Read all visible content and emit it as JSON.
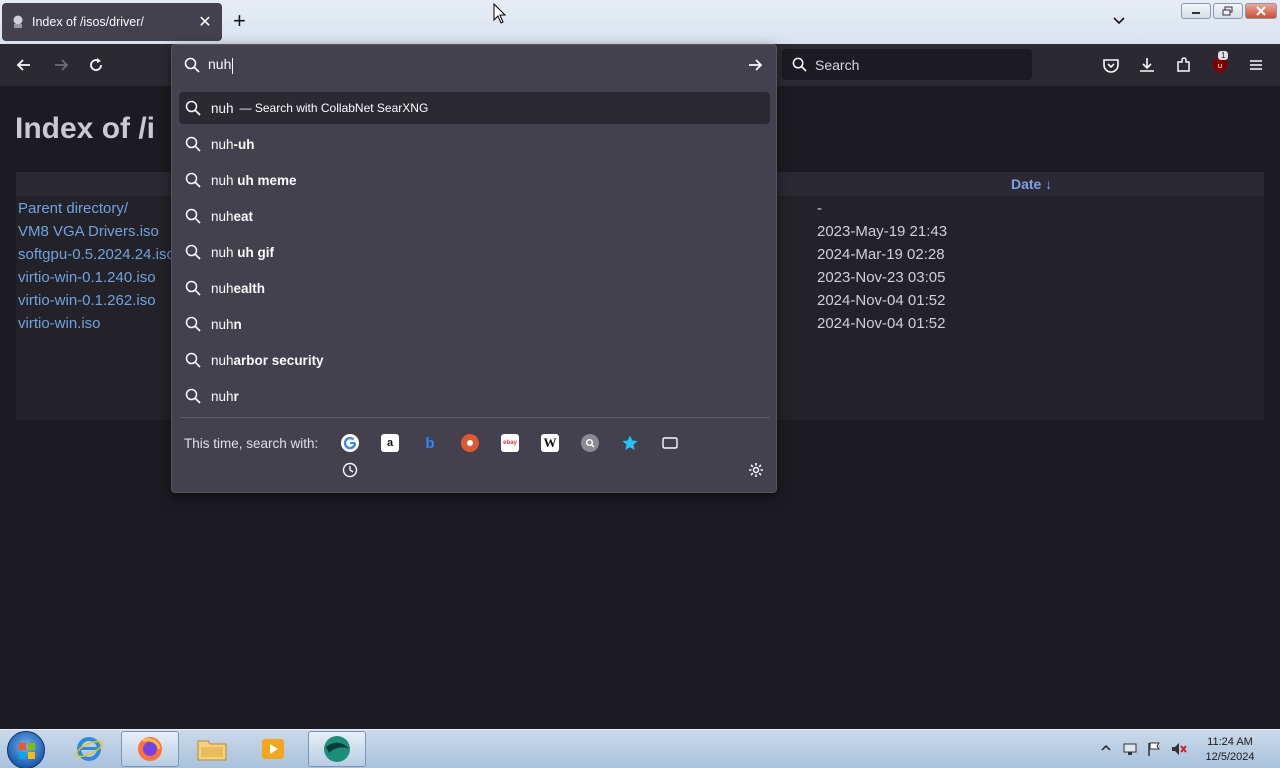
{
  "browser": {
    "tab": {
      "title": "Index of /isos/driver/",
      "close_glyph": "✕"
    },
    "new_tab_glyph": "+",
    "search_placeholder": "Search",
    "extension_badge": "1"
  },
  "page": {
    "title": "Index of /i",
    "date_header": "Date ↓",
    "files": [
      {
        "name": "Parent directory/",
        "date": "-"
      },
      {
        "name": "VM8 VGA Drivers.iso",
        "date": "2023-May-19 21:43"
      },
      {
        "name": "softgpu-0.5.2024.24.iso",
        "date": "2024-Mar-19 02:28"
      },
      {
        "name": "virtio-win-0.1.240.iso",
        "date": "2023-Nov-23 03:05"
      },
      {
        "name": "virtio-win-0.1.262.iso",
        "date": "2024-Nov-04 01:52"
      },
      {
        "name": "virtio-win.iso",
        "date": "2024-Nov-04 01:52"
      }
    ]
  },
  "urlbar": {
    "value": "nuh",
    "first_suggestion": {
      "text": "nuh",
      "engine_label": "— Search with CollabNet SearXNG"
    },
    "suggestions": [
      {
        "prefix": "nuh",
        "bold": "-uh"
      },
      {
        "prefix": "nuh ",
        "bold": "uh meme"
      },
      {
        "prefix": "nuh",
        "bold": "eat"
      },
      {
        "prefix": "nuh ",
        "bold": "uh gif"
      },
      {
        "prefix": "nuh",
        "bold": "ealth"
      },
      {
        "prefix": "nuh",
        "bold": "n"
      },
      {
        "prefix": "nuh",
        "bold": "arbor security"
      },
      {
        "prefix": "nuh",
        "bold": "r"
      }
    ],
    "one_off_label": "This time, search with:",
    "engines": [
      "google-icon",
      "amazon-icon",
      "bing-icon",
      "duckduckgo-icon",
      "ebay-icon",
      "wikipedia-icon",
      "searxng-icon",
      "bookmarks-icon",
      "tabs-icon",
      "history-icon"
    ]
  },
  "taskbar": {
    "time": "11:24 AM",
    "date": "12/5/2024"
  }
}
